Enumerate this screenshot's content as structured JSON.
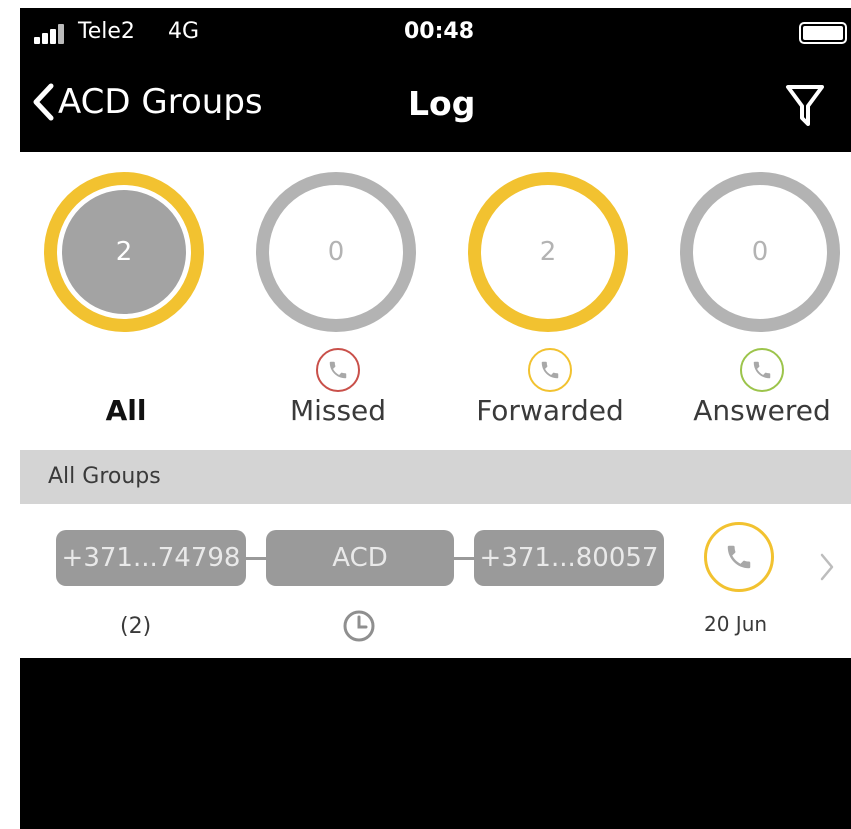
{
  "status_bar": {
    "carrier": "Tele2",
    "network": "4G",
    "time": "00:48"
  },
  "nav": {
    "back_label": "ACD Groups",
    "title": "Log",
    "filter_icon": "filter-icon"
  },
  "stats": [
    {
      "label": "All",
      "value": "2",
      "active": true,
      "filled": true
    },
    {
      "label": "Missed",
      "value": "0",
      "active": false,
      "icon": "phone-missed-icon",
      "icon_color": "#c9504a"
    },
    {
      "label": "Forwarded",
      "value": "2",
      "active": true,
      "icon": "phone-forwarded-icon",
      "icon_color": "#f2c230"
    },
    {
      "label": "Answered",
      "value": "0",
      "active": false,
      "icon": "phone-answered-icon",
      "icon_color": "#9cc44b"
    }
  ],
  "section": {
    "title": "All Groups"
  },
  "log_row": {
    "from": "+371...74798",
    "via": "ACD",
    "to": "+371...80057",
    "count": "(2)",
    "date": "20 Jun"
  },
  "colors": {
    "accent": "#f2c230",
    "inactive": "#b3b3b3",
    "pill": "#9a9a9a",
    "section_bg": "#d4d4d4"
  }
}
